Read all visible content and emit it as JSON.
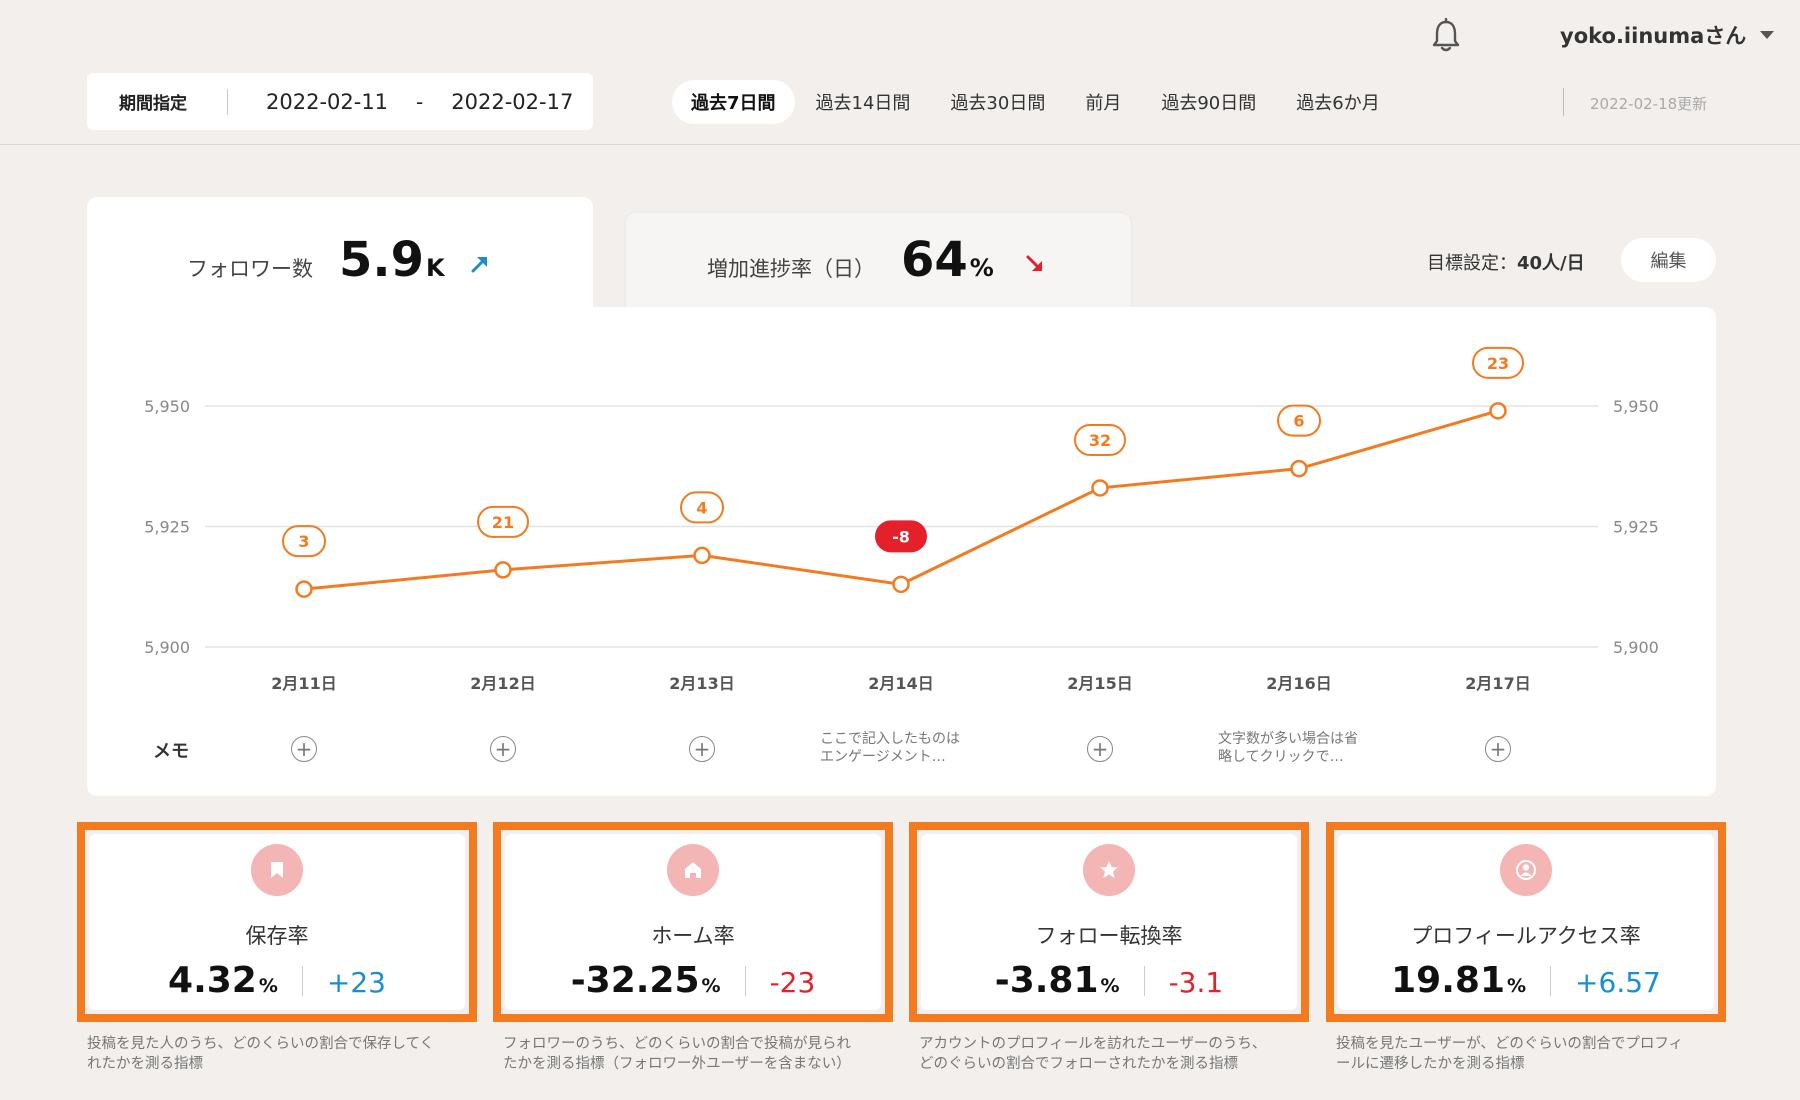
{
  "header": {
    "user_name": "yoko.iinumaさん",
    "bell_icon": "bell-icon",
    "period_label": "期間指定",
    "start_date": "2022-02-11",
    "date_separator": "-",
    "end_date": "2022-02-17",
    "tabs": [
      {
        "label": "過去7日間",
        "active": true
      },
      {
        "label": "過去14日間",
        "active": false
      },
      {
        "label": "過去30日間",
        "active": false
      },
      {
        "label": "前月",
        "active": false
      },
      {
        "label": "過去90日間",
        "active": false
      },
      {
        "label": "過去6か月",
        "active": false
      }
    ],
    "updated": "2022-02-18更新"
  },
  "summary": {
    "followers_label": "フォロワー数",
    "followers_value": "5.9",
    "followers_unit": "K",
    "progress_label": "増加進捗率（日）",
    "progress_value": "64",
    "progress_unit": "%",
    "goal_label": "目標設定：",
    "goal_value": "40人/日",
    "edit_label": "編集"
  },
  "colors": {
    "accent": "#f47a20",
    "line": "#f47a20",
    "positive": "#1a8fcf",
    "negative": "#e4202a",
    "icon_bg": "#f4b5b5"
  },
  "chart_data": {
    "type": "line",
    "categories": [
      "2月11日",
      "2月12日",
      "2月13日",
      "2月14日",
      "2月15日",
      "2月16日",
      "2月17日"
    ],
    "values": [
      5912,
      5916,
      5919,
      5913,
      5933,
      5937,
      5949
    ],
    "point_labels": [
      "3",
      "21",
      "4",
      "-8",
      "32",
      "6",
      "23"
    ],
    "ylim": [
      5900,
      5950
    ],
    "yticks": [
      "5,900",
      "5,925",
      "5,950"
    ],
    "grid": true
  },
  "memo": {
    "label": "メモ",
    "notes": [
      {
        "index": 3,
        "line1": "ここで記入したものは",
        "line2": "エンゲージメント…"
      },
      {
        "index": 5,
        "line1": "文字数が多い場合は省",
        "line2": "略してクリックで…"
      }
    ]
  },
  "metrics": [
    {
      "title": "保存率",
      "value": "4.32",
      "unit": "%",
      "delta": "+23",
      "sign": "pos",
      "icon": "bookmark-icon",
      "desc1": "投稿を見た人のうち、どのくらいの割合で保存してく",
      "desc2": "れたかを測る指標"
    },
    {
      "title": "ホーム率",
      "value": "-32.25",
      "unit": "%",
      "delta": "-23",
      "sign": "neg",
      "icon": "home-icon",
      "desc1": "フォロワーのうち、どのくらいの割合で投稿が見られ",
      "desc2": "たかを測る指標（フォロワー外ユーザーを含まない）"
    },
    {
      "title": "フォロー転換率",
      "value": "-3.81",
      "unit": "%",
      "delta": "-3.1",
      "sign": "neg",
      "icon": "star-icon",
      "desc1": "アカウントのプロフィールを訪れたユーザーのうち、",
      "desc2": "どのぐらいの割合でフォローされたかを測る指標"
    },
    {
      "title": "プロフィールアクセス率",
      "value": "19.81",
      "unit": "%",
      "delta": "+6.57",
      "sign": "pos",
      "icon": "user-icon",
      "desc1": "投稿を見たユーザーが、どのぐらいの割合でプロフィ",
      "desc2": "ールに遷移したかを測る指標"
    }
  ]
}
